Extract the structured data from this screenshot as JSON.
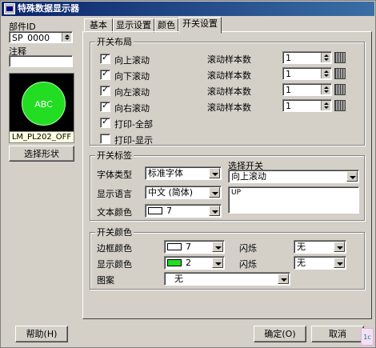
{
  "window": {
    "title": "特殊数据显示器"
  },
  "left": {
    "part_id_label": "部件ID",
    "part_id_value": "SP_0000",
    "comment_label": "注释",
    "comment_value": "",
    "preview_text": "ABC",
    "preview_name": "LM_PL202_OFF",
    "select_shape_button": "选择形状"
  },
  "tabs": [
    {
      "label": "基本",
      "active": false
    },
    {
      "label": "显示设置",
      "active": false
    },
    {
      "label": "颜色",
      "active": false
    },
    {
      "label": "开关设置",
      "active": true
    }
  ],
  "layout_group": {
    "title": "开关布局",
    "checkboxes": [
      {
        "label": "向上滚动",
        "checked": true
      },
      {
        "label": "向下滚动",
        "checked": true
      },
      {
        "label": "向左滚动",
        "checked": true
      },
      {
        "label": "向右滚动",
        "checked": true
      },
      {
        "label": "打印-全部",
        "checked": true
      },
      {
        "label": "打印-显示",
        "checked": false
      }
    ],
    "samples": [
      {
        "label": "滚动样本数",
        "value": "1"
      },
      {
        "label": "滚动样本数",
        "value": "1"
      },
      {
        "label": "滚动样本数",
        "value": "1"
      },
      {
        "label": "滚动样本数",
        "value": "1"
      }
    ]
  },
  "label_group": {
    "title": "开关标签",
    "font_type_label": "字体类型",
    "font_type_value": "标准字体",
    "language_label": "显示语言",
    "language_value": "中文 (简体)",
    "text_color_label": "文本颜色",
    "text_color_value": "7",
    "text_color_swatch": "#ffffff",
    "select_switch_label": "选择开关",
    "select_switch_value": "向上滚动",
    "switch_text": "UP"
  },
  "color_group": {
    "title": "开关颜色",
    "border_color_label": "边框颜色",
    "border_color_value": "7",
    "border_color_swatch": "#ffffff",
    "display_color_label": "显示颜色",
    "display_color_value": "2",
    "display_color_swatch": "#22dd22",
    "blink_label_1": "闪烁",
    "blink_value_1": "无",
    "blink_label_2": "闪烁",
    "blink_value_2": "无",
    "pattern_label": "图案",
    "pattern_value": "无"
  },
  "footer": {
    "help_button": "帮助(H)",
    "ok_button": "确定(O)",
    "cancel_button": "取消",
    "corner_badge": "1c"
  }
}
